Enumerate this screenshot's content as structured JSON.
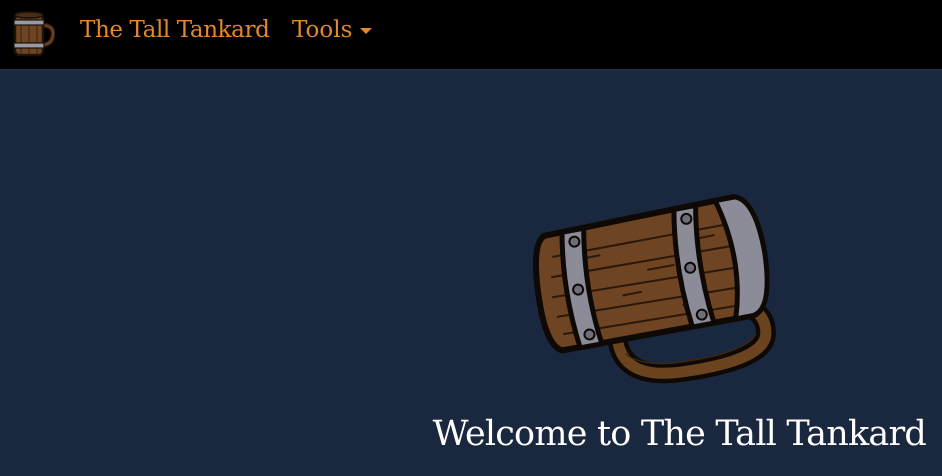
{
  "navbar": {
    "logo_icon": "tankard-icon",
    "brand": "The Tall Tankard",
    "tools_label": "Tools",
    "tools_icon": "caret-down-icon",
    "accent_color": "#e0892e",
    "background_color": "#000000"
  },
  "hero": {
    "image_icon": "tankard-mug-illustration",
    "title": "Welcome to The Tall Tankard",
    "background_color": "#19273f"
  }
}
